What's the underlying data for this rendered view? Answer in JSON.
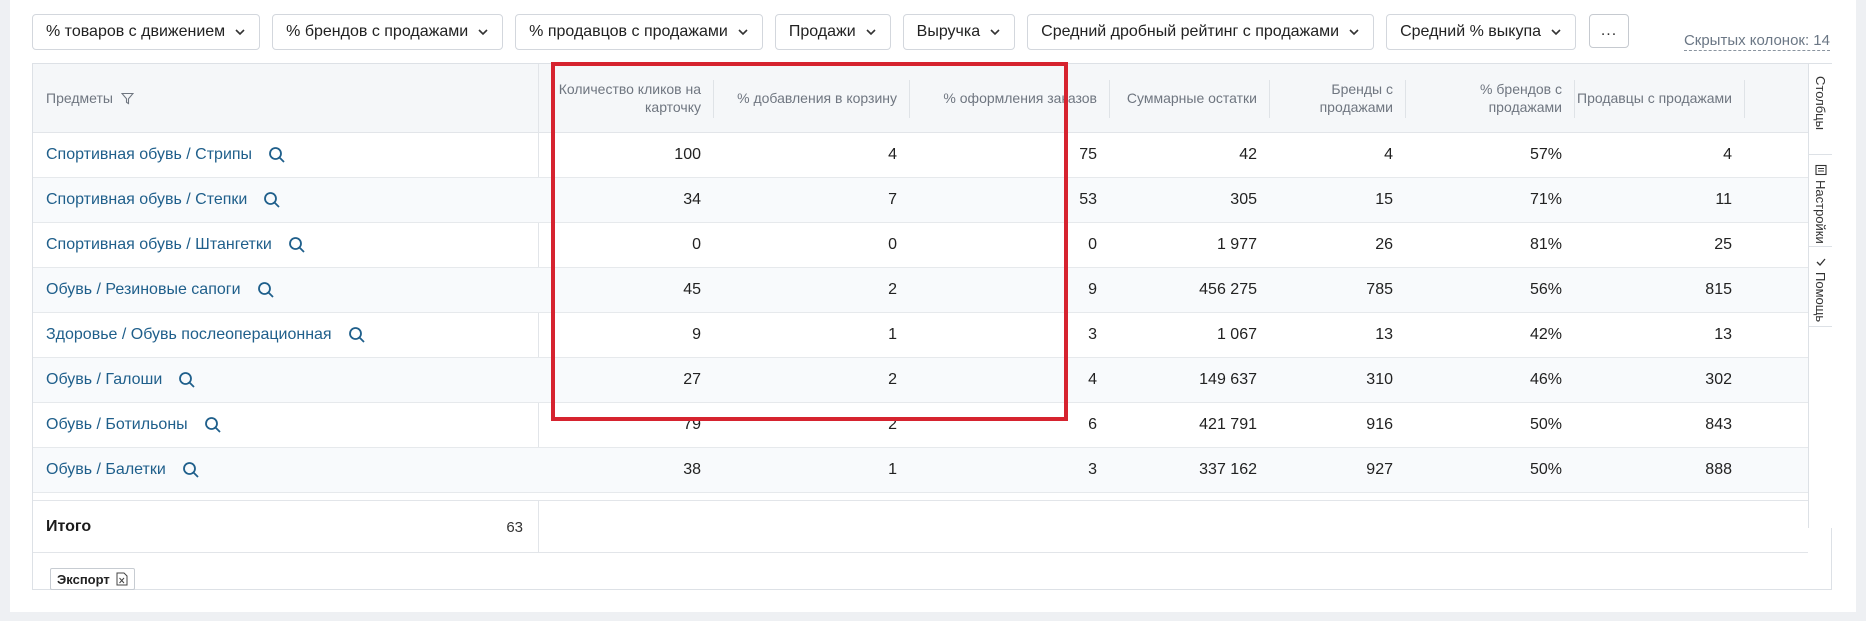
{
  "filters": [
    {
      "label": "% товаров с движением"
    },
    {
      "label": "% брендов с продажами"
    },
    {
      "label": "% продавцов с продажами"
    },
    {
      "label": "Продажи"
    },
    {
      "label": "Выручка"
    },
    {
      "label": "Средний дробный рейтинг с продажами"
    },
    {
      "label": "Средний % выкупа"
    }
  ],
  "more_label": "...",
  "hidden_columns": "Скрытых колонок: 14",
  "table": {
    "headers": {
      "subject": "Предметы",
      "clicks": "Количество кликов на карточку",
      "cart": "% добавления в корзину",
      "orders": "% оформления заказов",
      "stock": "Суммарные остатки",
      "brands": "Бренды с продажами",
      "brands_pct": "% брендов с продажами",
      "sellers": "Продавцы с продажами"
    },
    "rows": [
      {
        "subject": "Спортивная обувь / Стрипы",
        "clicks": "100",
        "cart": "4",
        "orders": "75",
        "stock": "42",
        "brands": "4",
        "brands_pct": "57%",
        "sellers": "4"
      },
      {
        "subject": "Спортивная обувь / Степки",
        "clicks": "34",
        "cart": "7",
        "orders": "53",
        "stock": "305",
        "brands": "15",
        "brands_pct": "71%",
        "sellers": "11"
      },
      {
        "subject": "Спортивная обувь / Штангетки",
        "clicks": "0",
        "cart": "0",
        "orders": "0",
        "stock": "1 977",
        "brands": "26",
        "brands_pct": "81%",
        "sellers": "25"
      },
      {
        "subject": "Обувь / Резиновые сапоги",
        "clicks": "45",
        "cart": "2",
        "orders": "9",
        "stock": "456 275",
        "brands": "785",
        "brands_pct": "56%",
        "sellers": "815"
      },
      {
        "subject": "Здоровье / Обувь послеоперационная",
        "clicks": "9",
        "cart": "1",
        "orders": "3",
        "stock": "1 067",
        "brands": "13",
        "brands_pct": "42%",
        "sellers": "13"
      },
      {
        "subject": "Обувь / Галоши",
        "clicks": "27",
        "cart": "2",
        "orders": "4",
        "stock": "149 637",
        "brands": "310",
        "brands_pct": "46%",
        "sellers": "302"
      },
      {
        "subject": "Обувь / Ботильоны",
        "clicks": "79",
        "cart": "2",
        "orders": "6",
        "stock": "421 791",
        "brands": "916",
        "brands_pct": "50%",
        "sellers": "843"
      },
      {
        "subject": "Обувь / Балетки",
        "clicks": "38",
        "cart": "1",
        "orders": "3",
        "stock": "337 162",
        "brands": "927",
        "brands_pct": "50%",
        "sellers": "888"
      }
    ],
    "totals_label": "Итого",
    "totals_count": "63"
  },
  "export_label": "Экспорт",
  "side_tabs": {
    "columns": "Столбцы",
    "settings": "Настройки",
    "help": "Помощь"
  },
  "colors": {
    "link": "#1f5f8b",
    "highlight": "#d6232f",
    "header_bg": "#f5f7f9"
  }
}
